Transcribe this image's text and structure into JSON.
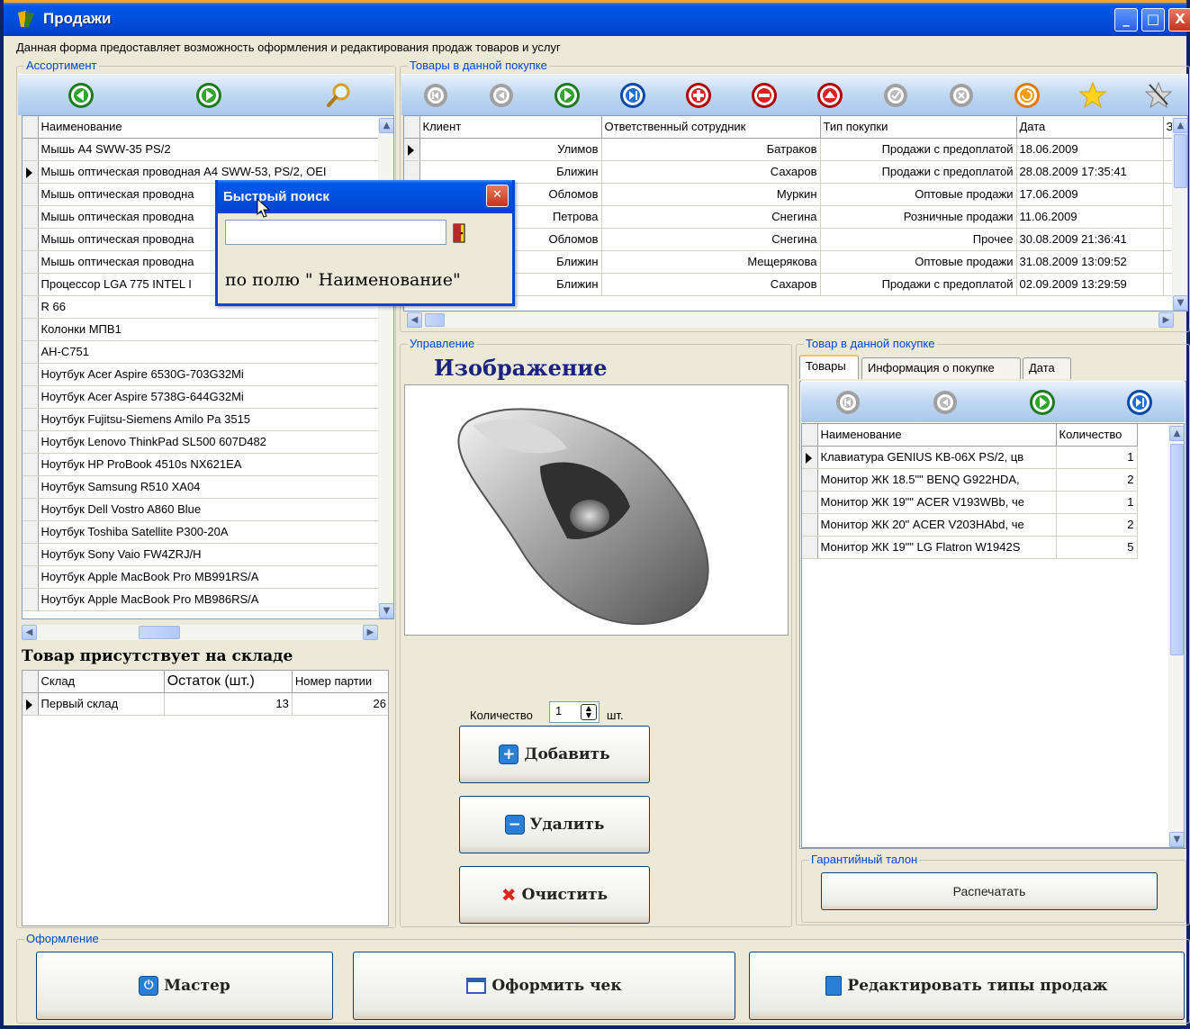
{
  "window": {
    "title": "Продажи",
    "description": "Данная форма предоставляет возможность оформления и редактирования продаж товаров и услуг",
    "controls": {
      "minimize": "_",
      "maximize": "□",
      "close": "X"
    }
  },
  "assortment": {
    "label": "Ассортимент",
    "toolbar": [
      "prev-green-icon",
      "next-green-icon",
      "search-magnifier-icon"
    ],
    "column": "Наименование",
    "items": [
      "Мышь A4 SWW-35 PS/2",
      "Мышь оптическая проводная A4 SWW-53, PS/2, OEI",
      "Мышь оптическая проводна",
      "Мышь оптическая проводна",
      "Мышь оптическая проводна",
      "Мышь оптическая проводна",
      "Процессор LGA 775 INTEL I",
      "R 66",
      "Колонки МПВ1",
      "AH-C751",
      "Ноутбук Acer Aspire 6530G-703G32Mi",
      "Ноутбук Acer Aspire 5738G-644G32Mi",
      "Ноутбук Fujitsu-Siemens Amilo Pa 3515",
      "Ноутбук Lenovo ThinkPad SL500 607D482",
      "Ноутбук HP ProBook 4510s NX621EA",
      "Ноутбук Samsung R510 XA04",
      "Ноутбук Dell Vostro A860 Blue",
      "Ноутбук Toshiba Satellite P300-20A",
      "Ноутбук Sony Vaio FW4ZRJ/H",
      "Ноутбук Apple MacBook Pro MB991RS/A",
      "Ноутбук Apple MacBook Pro MB986RS/A"
    ],
    "selected_index": 1
  },
  "stock": {
    "heading": "Товар присутствует на складе",
    "columns": [
      "Склад",
      "Остаток (шт.)",
      "Номер партии"
    ],
    "rows": [
      [
        "Первый склад",
        "13",
        "26"
      ]
    ]
  },
  "purchases": {
    "label": "Товары в данной покупке",
    "columns": [
      "Клиент",
      "Ответственный сотрудник",
      "Тип покупки",
      "Дата",
      "З"
    ],
    "rows": [
      [
        "Улимов",
        "Батраков",
        "Продажи с предоплатой",
        "18.06.2009"
      ],
      [
        "Ближин",
        "Сахаров",
        "Продажи с предоплатой",
        "28.08.2009 17:35:41"
      ],
      [
        "Обломов",
        "Муркин",
        "Оптовые продажи",
        "17.06.2009"
      ],
      [
        "Петрова",
        "Снегина",
        "Розничные продажи",
        "11.06.2009"
      ],
      [
        "Обломов",
        "Снегина",
        "Прочее",
        "30.08.2009 21:36:41"
      ],
      [
        "Ближин",
        "Мещерякова",
        "Оптовые продажи",
        "31.08.2009 13:09:52"
      ],
      [
        "Ближин",
        "Сахаров",
        "Продажи с предоплатой",
        "02.09.2009 13:29:59"
      ]
    ]
  },
  "management": {
    "label": "Управление",
    "image_heading": "Изображение",
    "quantity_label": "Количество",
    "quantity_value": "1",
    "quantity_unit": "шт.",
    "add_button": "Добавить",
    "delete_button": "Удалить",
    "clear_button": "Очистить"
  },
  "purchase_items": {
    "label": "Товар в данной покупке",
    "tabs": [
      "Товары",
      "Информация о покупке",
      "Дата"
    ],
    "columns": [
      "Наименование",
      "Количество"
    ],
    "rows": [
      [
        "Клавиатура GENIUS KB-06X PS/2, цв",
        "1"
      ],
      [
        "Монитор ЖК 18.5\"\" BENQ G922HDA,",
        "2"
      ],
      [
        "Монитор ЖК 19\"\" ACER V193WBb, че",
        "1"
      ],
      [
        "Монитор ЖК 20\" ACER V203HAbd, че",
        "2"
      ],
      [
        "Монитор ЖК 19\"\" LG Flatron W1942S",
        "5"
      ]
    ]
  },
  "warranty": {
    "label": "Гарантийный талон",
    "print_button": "Распечатать"
  },
  "registration": {
    "label": "Оформление",
    "master_button": "Мастер",
    "receipt_button": "Оформить чек",
    "edit_types_button": "Редактировать типы продаж"
  },
  "quick_search": {
    "title": "Быстрый поиск",
    "input_value": "",
    "hint": "по полю \" Наименование\""
  }
}
